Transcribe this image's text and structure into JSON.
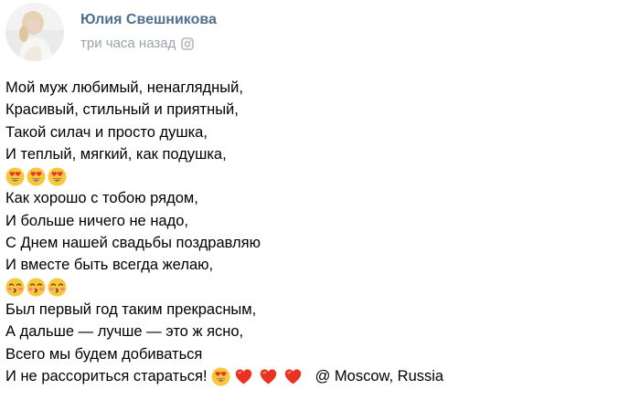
{
  "post": {
    "author_name": "Юлия Свешникова",
    "time": "три часа назад",
    "time_icon": "camera-icon",
    "avatar": "user-avatar-photo"
  },
  "body": {
    "stanza1": [
      "Мой муж любимый, ненаглядный,",
      "Красивый, стильный и приятный,",
      "Такой силач и просто душка,",
      "И теплый, мягкий, как подушка,"
    ],
    "emoji_row1": [
      "heart-eyes-emoji",
      "heart-eyes-emoji",
      "heart-eyes-emoji"
    ],
    "stanza2": [
      "Как хорошо с тобою рядом,",
      "И больше ничего не надо,",
      "С Днем нашей свадьбы поздравляю",
      "И вместе быть всегда желаю,"
    ],
    "emoji_row2": [
      "kissing-face-emoji",
      "kissing-face-emoji",
      "kissing-face-emoji"
    ],
    "stanza3": [
      "Был первый год таким прекрасным,",
      "А дальше — лучше — это ж ясно,",
      "Всего мы будем добиваться"
    ],
    "last_line_text": "И не рассориться стараться!",
    "last_line_emojis": [
      "heart-eyes-emoji",
      "red-heart-emoji",
      "red-heart-emoji",
      "red-heart-emoji"
    ],
    "location": "@ Moscow, Russia"
  },
  "colors": {
    "author": "#4e6f90",
    "meta": "#9ca3ab",
    "text": "#000000"
  }
}
